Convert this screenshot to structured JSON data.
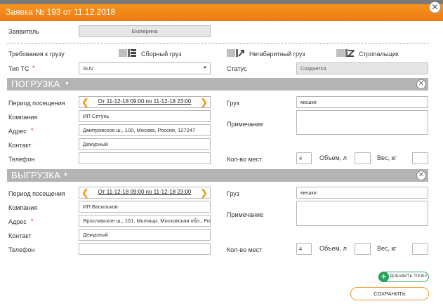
{
  "header": {
    "title": "Заявка № 193 от 11.12.2018",
    "accent_color": "#F28C1E"
  },
  "applicant": {
    "label": "Заявитель",
    "value": "Екатерина"
  },
  "cargo_requirements": {
    "label": "Требования к грузу",
    "options": [
      {
        "label": "Сборный груз",
        "icon": "consolidated-cargo-icon"
      },
      {
        "label": "Негабаритный груз",
        "icon": "oversized-cargo-icon"
      },
      {
        "label": "Стропальщик",
        "icon": "slinger-icon"
      }
    ]
  },
  "vehicle_type": {
    "label": "Тип ТС",
    "required_mark": "*",
    "value": "SUV"
  },
  "status": {
    "label": "Статус",
    "value": "Создается"
  },
  "sections": [
    {
      "title": "ПОГРУЗКА",
      "period_label": "Период посещения",
      "period_value": "От 11-12-18 09:00 по 11-12-18 23:00",
      "company_label": "Компания",
      "company_value": "ИП Сетунь",
      "address_label": "Адрес",
      "address_value": "Дмитровское ш., 100, Москва, Россия, 127247",
      "contact_label": "Контакт",
      "contact_value": "Дежурный",
      "phone_label": "Телефон",
      "phone_value": "",
      "cargo_label": "Груз",
      "cargo_value": "мешки",
      "note_label": "Примечание",
      "places_label": "Кол-во мест",
      "places_value": "4",
      "volume_label": "Объем, л",
      "weight_label": "Вес, кг"
    },
    {
      "title": "ВЫГРУЗКА",
      "period_label": "Период посещения",
      "period_value": "От 11-12-18 09:00 по 11-12-18 23:00",
      "company_label": "Компания",
      "company_value": "ИП Васильков",
      "address_label": "Адрес",
      "address_value": "Ярославское ш., 101, Мытищи, Московская обл., Ро",
      "contact_label": "Контакт",
      "contact_value": "Дежурный",
      "phone_label": "Телефон",
      "phone_value": "",
      "cargo_label": "Груз",
      "cargo_value": "мешки",
      "note_label": "Примечание",
      "places_label": "Кол-во мест",
      "places_value": "4",
      "volume_label": "Объем, л",
      "weight_label": "Вес, кг"
    }
  ],
  "actions": {
    "add_point_label": "ДОБАВИТЬ ТОЧКУ",
    "save_label": "СОХРАНИТЬ"
  }
}
